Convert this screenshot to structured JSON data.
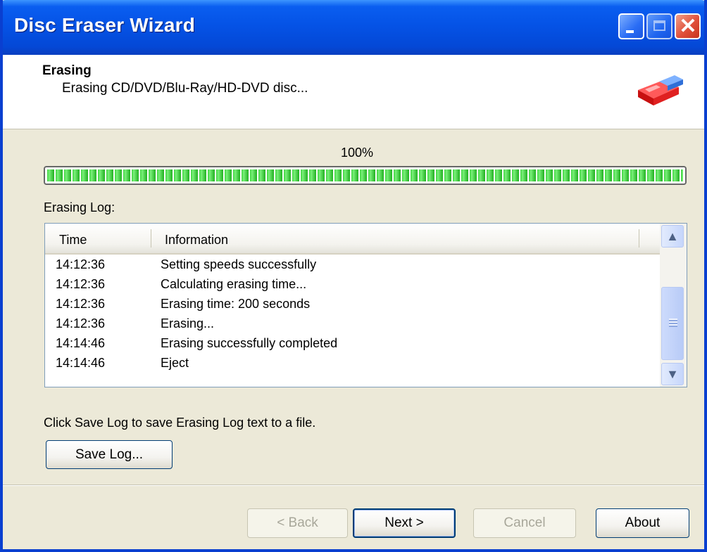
{
  "window": {
    "title": "Disc Eraser Wizard",
    "colors": {
      "titlebar": "#0553e6",
      "progress_fill": "#2cb82c",
      "close_button": "#e0503a"
    }
  },
  "header": {
    "title": "Erasing",
    "subtitle": "Erasing CD/DVD/Blu-Ray/HD-DVD disc...",
    "icon": "eraser-icon"
  },
  "progress": {
    "label": "100%",
    "value": 100
  },
  "log": {
    "label": "Erasing Log:",
    "columns": [
      "Time",
      "Information"
    ],
    "rows": [
      {
        "time": "14:12:36",
        "info": "Setting speeds successfully"
      },
      {
        "time": "14:12:36",
        "info": "Calculating erasing time..."
      },
      {
        "time": "14:12:36",
        "info": "Erasing time: 200 seconds"
      },
      {
        "time": "14:12:36",
        "info": "Erasing..."
      },
      {
        "time": "14:14:46",
        "info": "Erasing successfully completed"
      },
      {
        "time": "14:14:46",
        "info": "Eject"
      }
    ]
  },
  "hint": "Click Save Log to save Erasing Log text to a file.",
  "buttons": {
    "save_log": "Save Log...",
    "back": "< Back",
    "next": "Next >",
    "cancel": "Cancel",
    "about": "About"
  }
}
